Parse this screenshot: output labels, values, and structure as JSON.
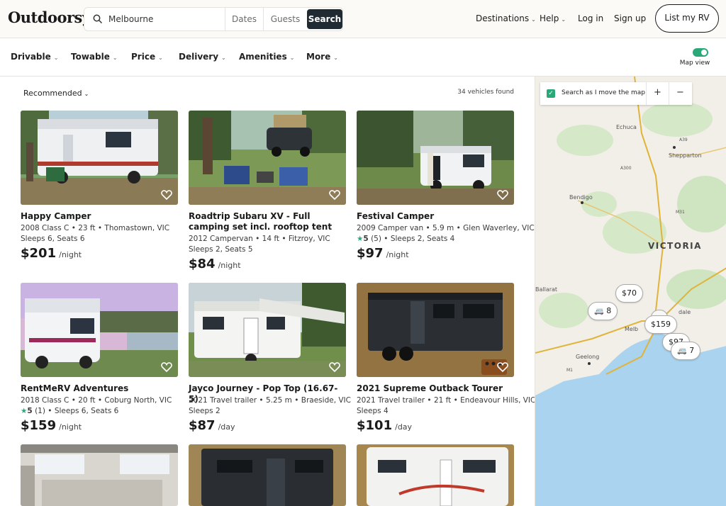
{
  "header": {
    "logo": "Outdoorsy",
    "search_value": "Melbourne",
    "dates_label": "Dates",
    "guests_label": "Guests",
    "search_button": "Search",
    "nav": {
      "destinations": "Destinations",
      "help": "Help",
      "login": "Log in",
      "signup": "Sign up"
    },
    "list_rv": "List my RV"
  },
  "filters": {
    "drivable": "Drivable",
    "towable": "Towable",
    "price": "Price",
    "delivery": "Delivery",
    "amenities": "Amenities",
    "more": "More",
    "map_view": "Map view"
  },
  "results": {
    "sort": "Recommended",
    "count": "34 vehicles found"
  },
  "listings": [
    {
      "title": "Happy Camper",
      "line1": "2008 Class C • 23 ft • Thomastown, VIC",
      "line2": "Sleeps 6, Seats 6",
      "price": "$201",
      "unit": "/night"
    },
    {
      "title": "Roadtrip Subaru XV - Full camping set incl. rooftop tent",
      "line1": "2012 Campervan • 14 ft • Fitzroy, VIC",
      "line2": "Sleeps 2, Seats 5",
      "price": "$84",
      "unit": "/night"
    },
    {
      "title": "Festival Camper",
      "line1": "2009 Camper van • 5.9 m • Glen Waverley, VIC",
      "rating": "5",
      "reviews": "(5)",
      "line2": " • Sleeps 2, Seats 4",
      "price": "$97",
      "unit": "/night"
    },
    {
      "title": "RentMeRV Adventures",
      "line1": "2018 Class C • 20 ft • Coburg North, VIC",
      "rating": "5",
      "reviews": "(1)",
      "line2": " • Sleeps 6, Seats 6",
      "price": "$159",
      "unit": "/night"
    },
    {
      "title": "Jayco Journey - Pop Top (16.67-5)",
      "line1": "2021 Travel trailer • 5.25 m • Braeside, VIC",
      "line2": "Sleeps 2",
      "price": "$87",
      "unit": "/day"
    },
    {
      "title": "2021 Supreme Outback Tourer",
      "line1": "2021 Travel trailer • 21 ft • Endeavour Hills, VIC",
      "line2": "Sleeps 4",
      "price": "$101",
      "unit": "/day"
    }
  ],
  "map": {
    "search_as_move": "Search as I move the map",
    "zoom_in": "+",
    "zoom_out": "−",
    "state_label": "VICTORIA",
    "places": {
      "echuca": "Echuca",
      "shepparton": "Shepparton",
      "bendigo": "Bendigo",
      "ballarat": "Ballarat",
      "geelong": "Geelong",
      "melbourne": "Melb",
      "dale": "dale"
    },
    "roads": {
      "a39": "A39",
      "a300": "A300",
      "m31": "M31",
      "m1": "M1"
    },
    "pins": {
      "p70": "$70",
      "c8": "8",
      "p159": "$159",
      "p97": "$97",
      "c7": "7"
    }
  },
  "colors": {
    "accent": "#2aa878",
    "dark_button": "#1f2a33",
    "water": "#a9d3ee",
    "land": "#f2efe8",
    "park": "#cfe5c1"
  }
}
